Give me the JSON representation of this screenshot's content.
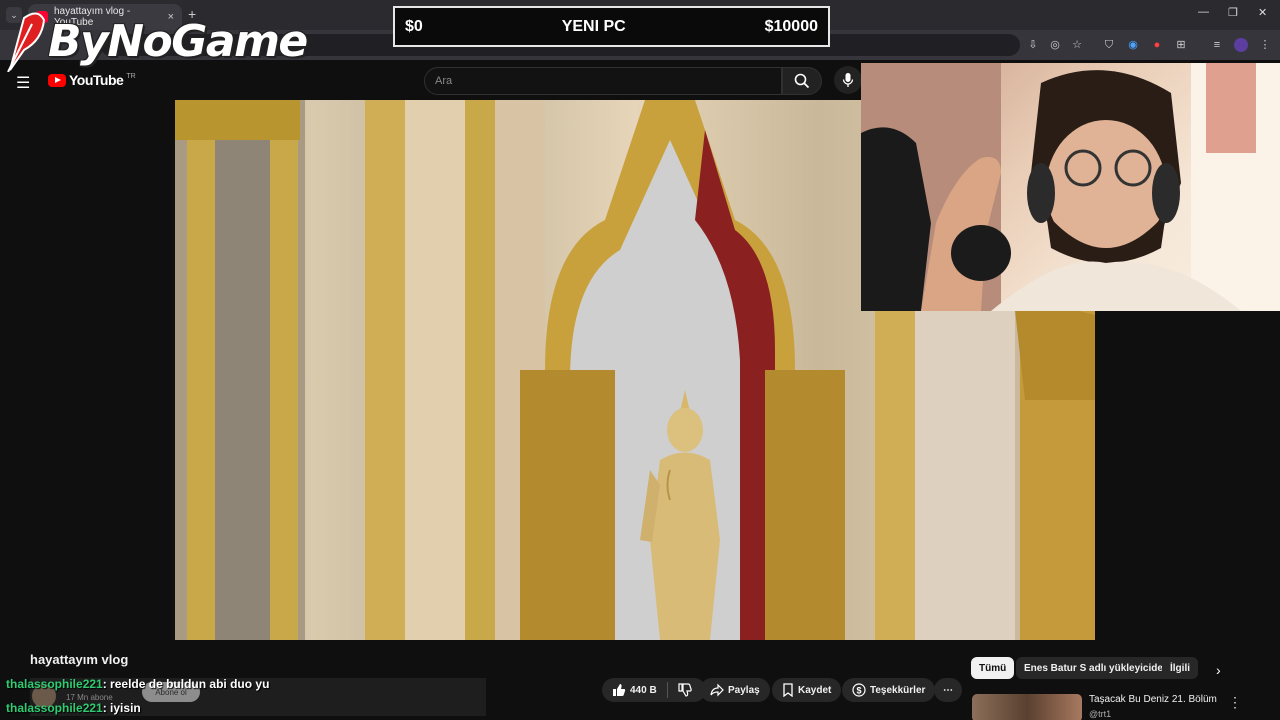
{
  "browser": {
    "tab_title": "hayattayım vlog - YouTube",
    "tab_close": "×",
    "new_tab": "+",
    "tab_menu": "⌄",
    "window_controls": [
      "—",
      "❐",
      "✕"
    ]
  },
  "youtube": {
    "menu_icon": "☰",
    "logo_text": "YouTube",
    "country_code": "TR",
    "search_placeholder": "Ara"
  },
  "overlay": {
    "brand": "ByNoGame",
    "goal": {
      "left": "$0",
      "center": "YENI PC",
      "right": "$10000",
      "progress": 0
    }
  },
  "video": {
    "title": "hayattayım vlog",
    "subscriber_count": "17 Mn abone",
    "subscribe_label": "Abone ol",
    "likes": "440 B",
    "share_label": "Paylaş",
    "save_label": "Kaydet",
    "thanks_label": "Teşekkürler",
    "more_label": "⋯"
  },
  "chat": [
    {
      "user": "thalassophile221",
      "message": ": reelde de buldun abi duo yu"
    },
    {
      "user": "thalassophile221",
      "message": ": iyisin"
    }
  ],
  "chips": [
    "Tümü",
    "Enes Batur S adlı yükleyiciden",
    "İlgili"
  ],
  "recommendation": {
    "title": "Taşacak Bu Deniz 21. Bölüm",
    "channel": "@trt1"
  },
  "colors": {
    "accent": "#ff0000",
    "chat_user": "#2ecc71",
    "goal_border": "#e6e6e6"
  }
}
